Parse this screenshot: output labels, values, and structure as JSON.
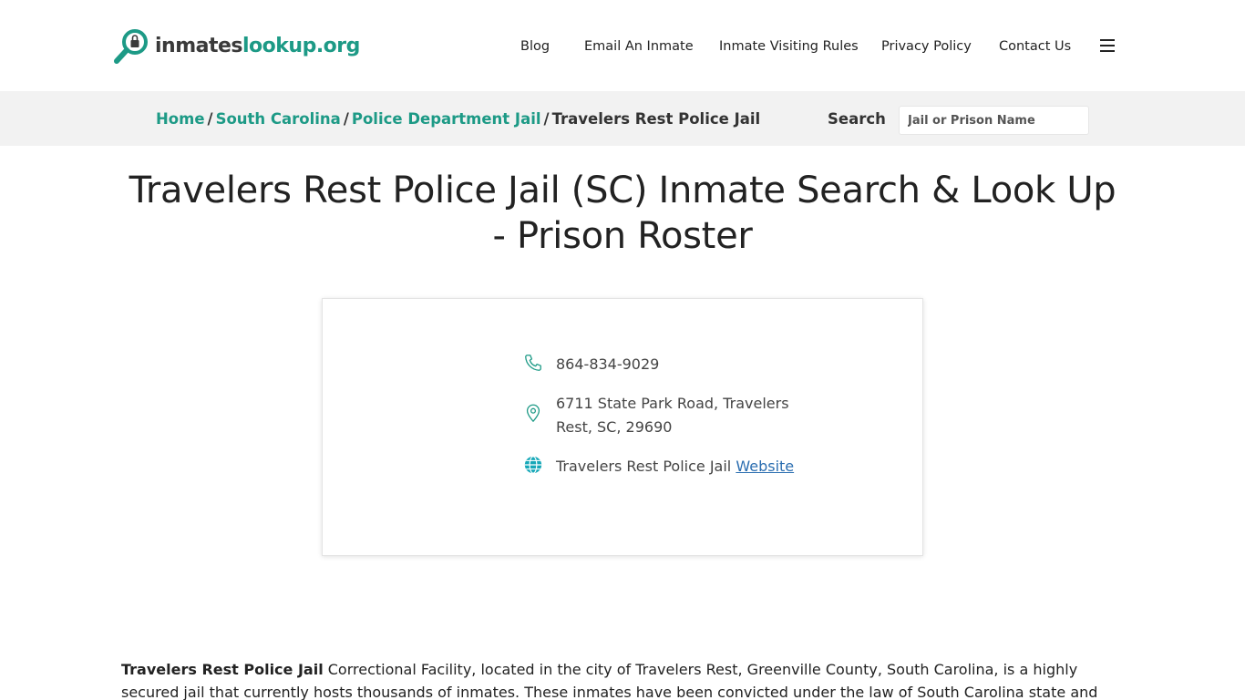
{
  "brand": {
    "name_part1": "inmates",
    "name_part2": "lookup.org"
  },
  "nav": {
    "items": [
      {
        "label": "Blog"
      },
      {
        "label": "Email An Inmate"
      },
      {
        "label": "Inmate Visiting Rules"
      },
      {
        "label": "Privacy Policy"
      },
      {
        "label": "Contact Us"
      }
    ],
    "menu_icon": "hamburger-icon"
  },
  "breadcrumb": {
    "items": [
      {
        "label": "Home"
      },
      {
        "label": "South Carolina"
      },
      {
        "label": "Police Department Jail"
      }
    ],
    "separator": "/",
    "current": "Travelers Rest Police Jail"
  },
  "search": {
    "label": "Search",
    "placeholder": "Jail or Prison Name",
    "value": ""
  },
  "page_title": "Travelers Rest Police Jail (SC) Inmate Search & Look Up - Prison Roster",
  "contact": {
    "phone": "864-834-9029",
    "address": "6711 State Park Road, Travelers Rest, SC, 29690",
    "website_prefix": "Travelers Rest Police Jail",
    "website_link": "Website",
    "icons": [
      "phone-icon",
      "location-pin-icon",
      "globe-icon"
    ]
  },
  "intro": {
    "bold": "Travelers Rest Police Jail",
    "text": " Correctional Facility, located in the city of Travelers Rest, Greenville County, South Carolina, is a highly secured jail that currently hosts thousands of inmates. These inmates have been convicted under the law of South Carolina state and according to the listed"
  },
  "colors": {
    "accent": "#1d9a86",
    "link": "#2a6db0",
    "bar": "#f2f2f2"
  }
}
